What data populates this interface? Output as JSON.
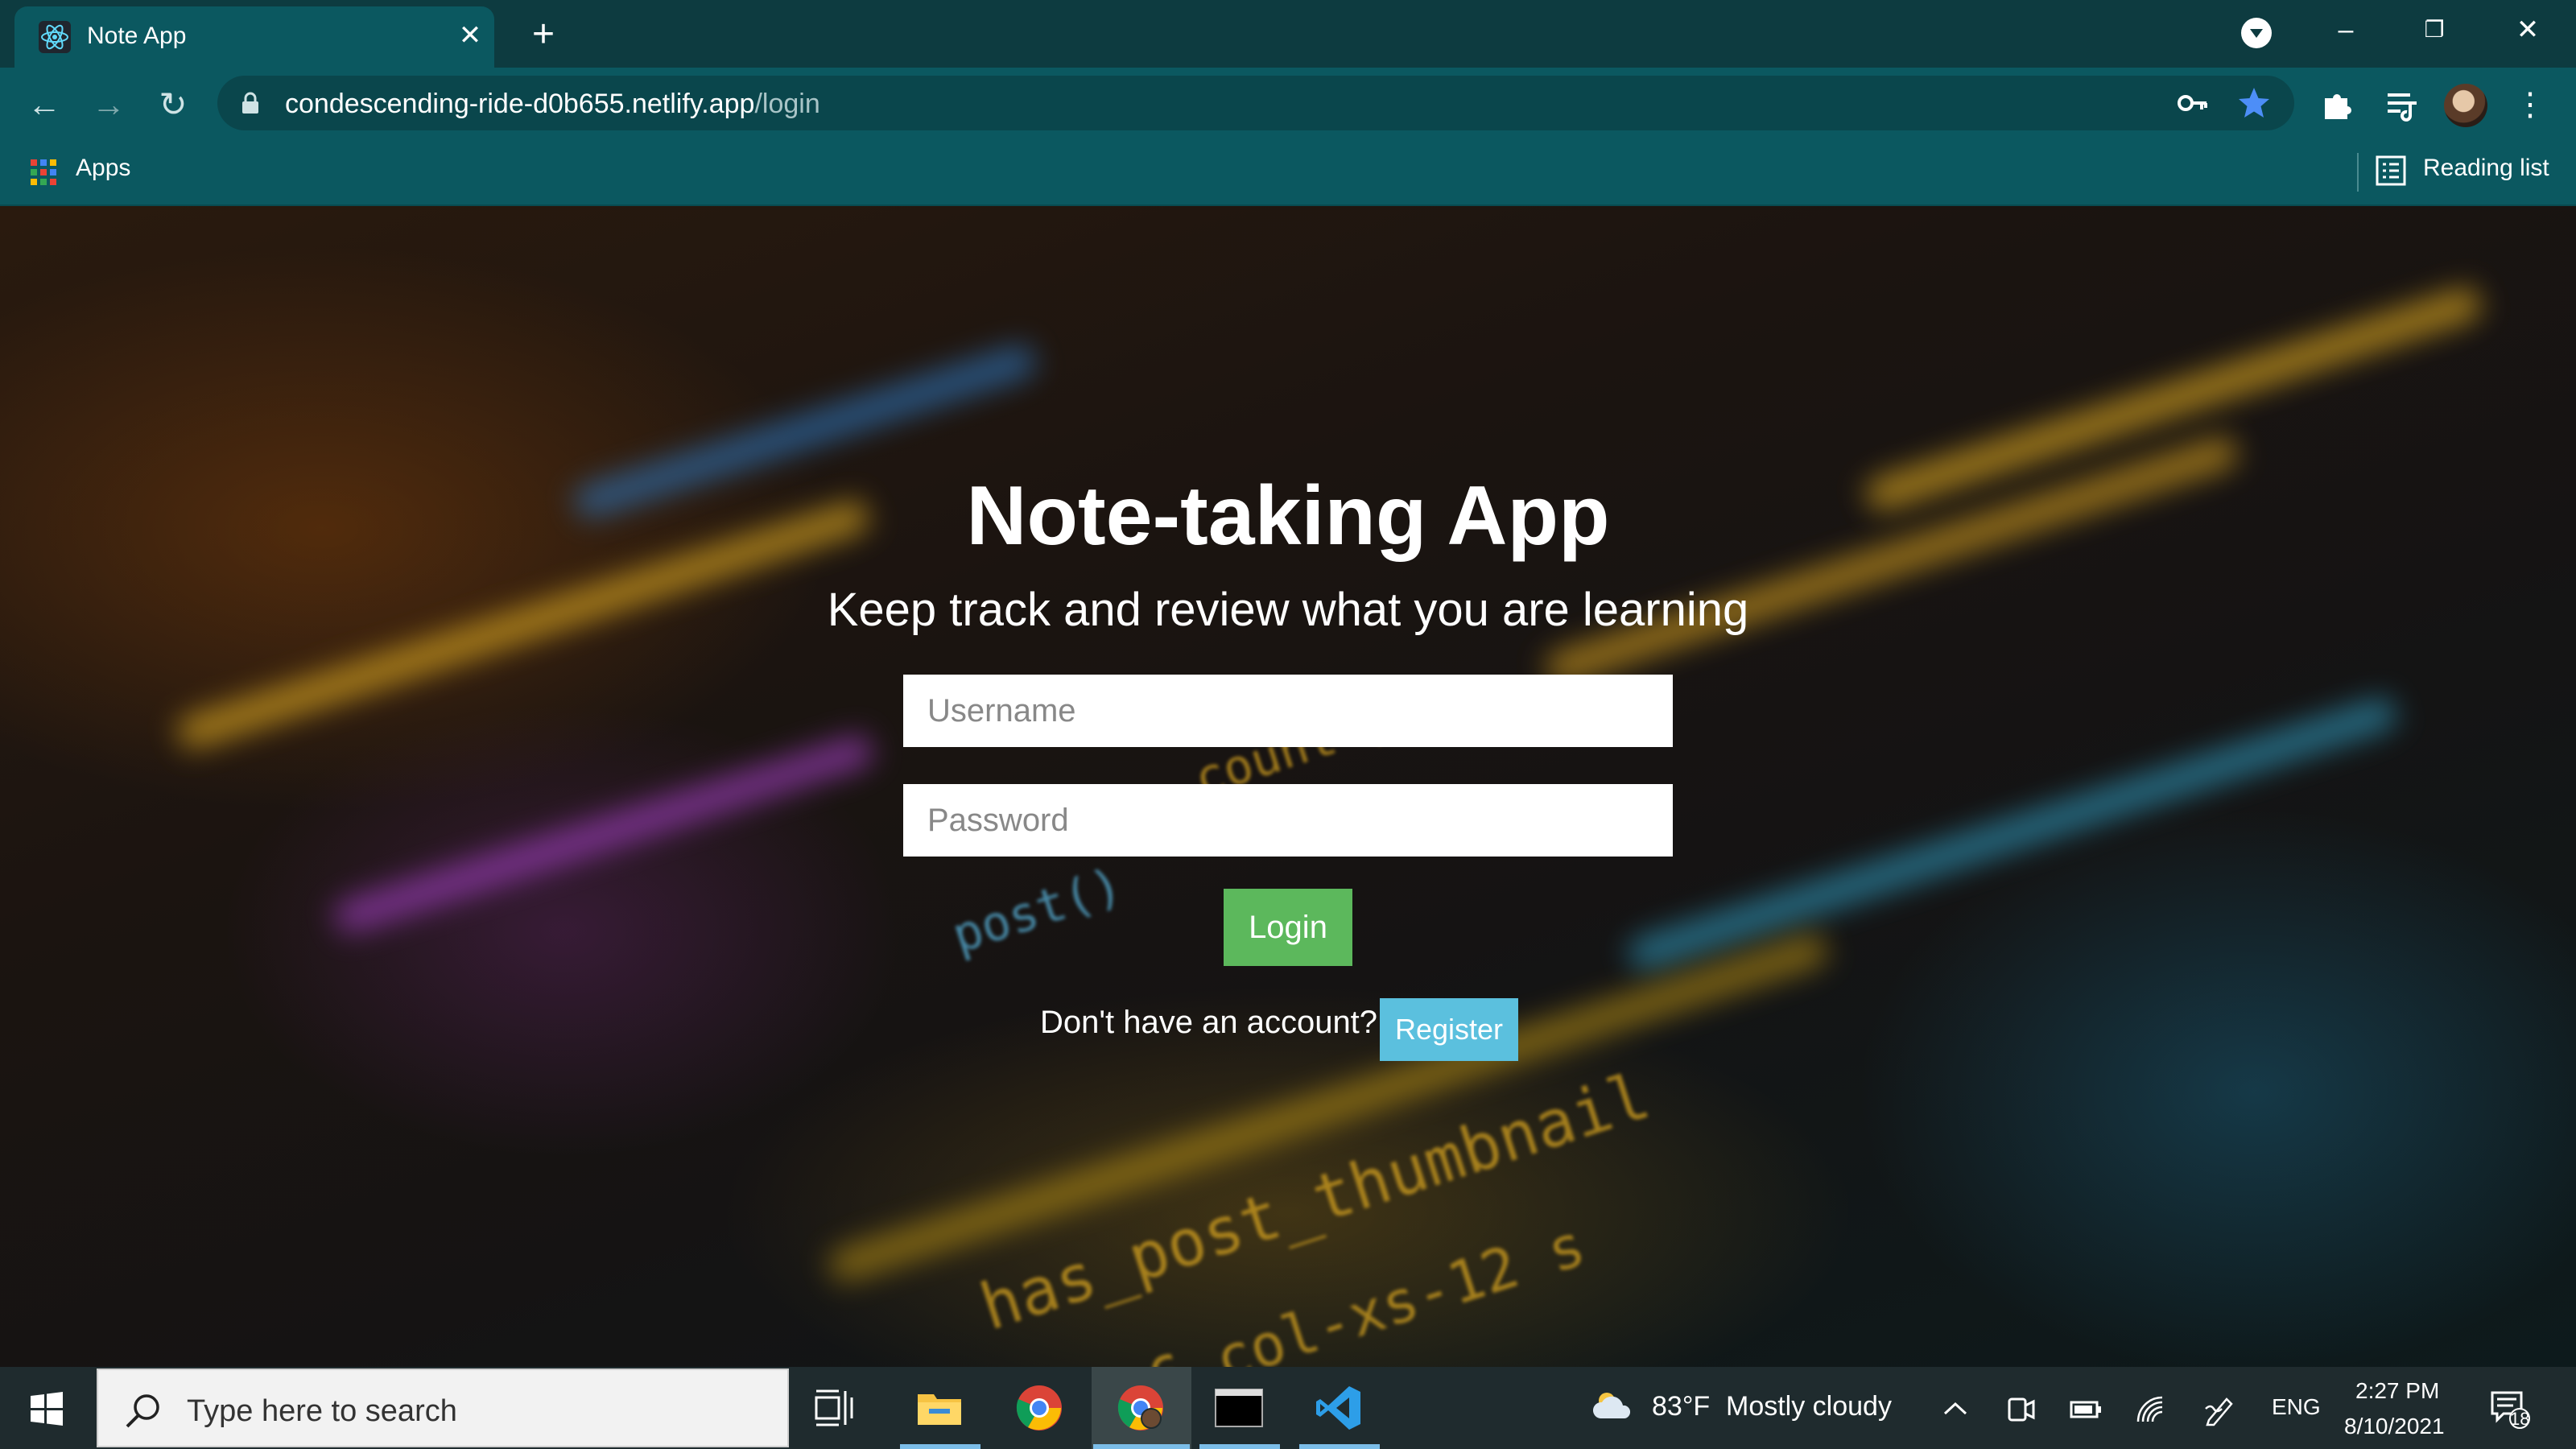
{
  "browser": {
    "tab_title": "Note App",
    "url_host": "condescending-ride-d0b655.netlify.app",
    "url_path": "/login",
    "bookmarks": {
      "apps_label": "Apps",
      "reading_list_label": "Reading list"
    }
  },
  "page": {
    "title": "Note-taking App",
    "subtitle": "Keep track and review what you are learning",
    "username_placeholder": "Username",
    "password_placeholder": "Password",
    "login_label": "Login",
    "no_account_text": "Don't have an account?",
    "register_label": "Register"
  },
  "taskbar": {
    "search_placeholder": "Type here to search",
    "weather_temp": "83°F",
    "weather_desc": "Mostly cloudy",
    "language": "ENG",
    "time": "2:27 PM",
    "date": "8/10/2021",
    "notification_count": "18"
  },
  "colors": {
    "chrome_dark": "#0d3b40",
    "chrome_teal": "#0b5860",
    "login_green": "#5cb85c",
    "register_blue": "#5bc0de",
    "taskbar": "#1f2b2e"
  }
}
